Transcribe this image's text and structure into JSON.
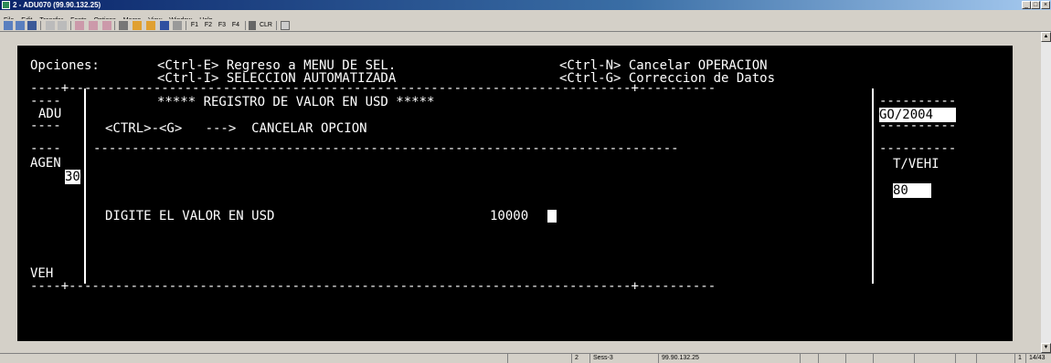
{
  "window": {
    "title": "2 - ADU070 (99.90.132.25)",
    "controls": [
      "_",
      "□",
      "×"
    ]
  },
  "menu": [
    "File",
    "Edit",
    "Transfer",
    "Fonts",
    "Options",
    "Macro",
    "View",
    "Window",
    "Help"
  ],
  "toolbar": {
    "func_keys": [
      "F1",
      "F2",
      "F3",
      "F4"
    ],
    "clr_label": "CLR"
  },
  "terminal": {
    "opciones_label": "Opciones:",
    "opt1": "<Ctrl-E> Regreso a MENU DE SEL.",
    "opt2": "<Ctrl-N> Cancelar OPERACION",
    "opt3": "<Ctrl-I> SELECCION AUTOMATIZADA",
    "opt4": "<Ctrl-G> Correccion de Datos",
    "dash_top": "----+-------------------------------------------------------------------------+----------",
    "dash_l1": "----",
    "dash_r1": "----------",
    "dash_l2": "----",
    "dash_r2": "----------",
    "dash_mid_l": "----",
    "dash_mid": "----------------------------------------------------------------------------",
    "dash_mid_r": "----------",
    "dash_bottom": "----+-------------------------------------------------------------------------+----------",
    "header": "***** REGISTRO DE VALOR EN USD *****",
    "adu_label": "ADU",
    "date_value": "GO/2004",
    "cancel_hint": "<CTRL>-<G>   --->  CANCELAR OPCION",
    "agen_label": "AGEN",
    "agen_value": "30",
    "tvehi_label": "T/VEHI",
    "tvehi_value": "80",
    "prompt": "DIGITE EL VALOR EN USD",
    "amount": "10000",
    "veh_label": "VEH"
  },
  "status": {
    "session_num": "2",
    "session": "Sess-3",
    "host": "99.90.132.25",
    "page_num": "1",
    "position": "14/43"
  }
}
